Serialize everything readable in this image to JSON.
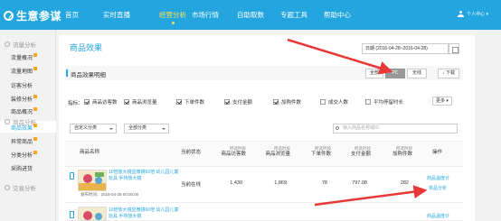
{
  "app": {
    "name": "生意参谋",
    "user": "个人中心"
  },
  "nav": [
    {
      "label": "首页"
    },
    {
      "label": "实时直播"
    },
    {
      "label": "经营分析"
    },
    {
      "label": "市场行情"
    },
    {
      "label": "自助取数"
    },
    {
      "label": "专题工具"
    },
    {
      "label": "帮助中心"
    }
  ],
  "sidebar": {
    "group1": "流量分析",
    "items1": [
      {
        "label": "流量概况"
      },
      {
        "label": "流量地图"
      },
      {
        "label": "访客分析"
      },
      {
        "label": "装修分析"
      }
    ],
    "group2": "商品分析",
    "items2": [
      {
        "label": "商品概况"
      },
      {
        "label": "商品效果"
      },
      {
        "label": "异常商品"
      },
      {
        "label": "分类分析"
      },
      {
        "label": "采购进货"
      }
    ],
    "group3": "交易分析"
  },
  "page": {
    "title": "商品效果",
    "date_range": "日期 (2016-04-28~2016-04-28)"
  },
  "section": {
    "title": "商品效果明细",
    "segments": [
      {
        "label": "全部"
      },
      {
        "label": "PC"
      },
      {
        "label": "无线"
      }
    ],
    "download": "下载"
  },
  "metrics": {
    "label": "指标：",
    "items": [
      {
        "label": "商品访客数"
      },
      {
        "label": "商品浏览量"
      },
      {
        "label": "下单件数"
      },
      {
        "label": "支付金额"
      },
      {
        "label": "加购件数"
      },
      {
        "label": "成交人数"
      },
      {
        "label": "平均停留时长"
      }
    ],
    "more": "更多"
  },
  "filters": {
    "cat1": "自定义分类",
    "cat2": "全部分类",
    "search_placeholder": "输入商品名称或ID"
  },
  "table": {
    "headers": {
      "name": "商品名称",
      "status": "当前状态",
      "sub": "所选时段"
    },
    "cols": [
      "商品访客数",
      "商品浏览量",
      "下单件数",
      "支付金额",
      "加购件数"
    ],
    "op": "操作",
    "rows": [
      {
        "name": "10倍放大镜显微镜60倍 幼儿园儿童玩具 手持放大镜",
        "time": "发布时间：2016-04-28 00:00:00",
        "status": "当前在线",
        "values": [
          "1,430",
          "1,869",
          "78",
          "797.08",
          "282"
        ],
        "op1": "商品温度计",
        "op2": "单品分析"
      },
      {
        "name": "10倍放大镜显微镜60倍 幼儿园儿童玩具 手持放大镜",
        "op1": "商品温度计"
      }
    ]
  },
  "colors": {
    "accent": "#23a6df",
    "arrow": "#e83838",
    "active_nav": "#ffe14d"
  }
}
